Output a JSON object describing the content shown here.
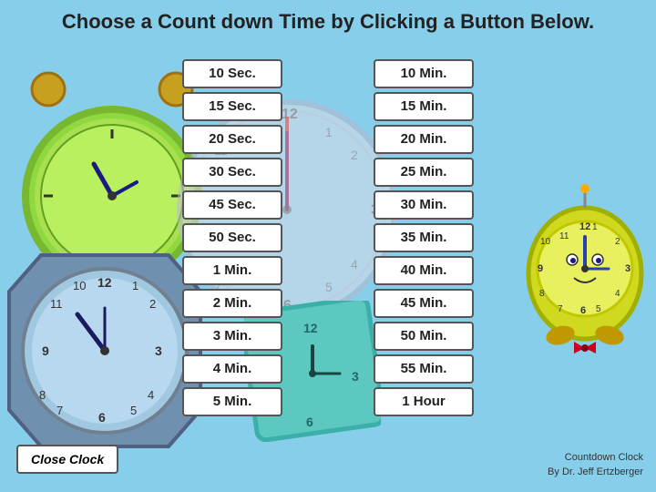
{
  "title": "Choose a Count down Time by Clicking a Button Below.",
  "left_column": [
    "10 Sec.",
    "15 Sec.",
    "20 Sec.",
    "30 Sec.",
    "45 Sec.",
    "50 Sec.",
    "1 Min.",
    "2 Min.",
    "3 Min.",
    "4 Min.",
    "5 Min."
  ],
  "right_column": [
    "10 Min.",
    "15 Min.",
    "20 Min.",
    "25 Min.",
    "30 Min.",
    "35 Min.",
    "40 Min.",
    "45 Min.",
    "50 Min.",
    "55 Min.",
    "1 Hour"
  ],
  "close_button_label": "Close Clock",
  "attribution_line1": "Countdown Clock",
  "attribution_line2": "By Dr. Jeff Ertzberger"
}
